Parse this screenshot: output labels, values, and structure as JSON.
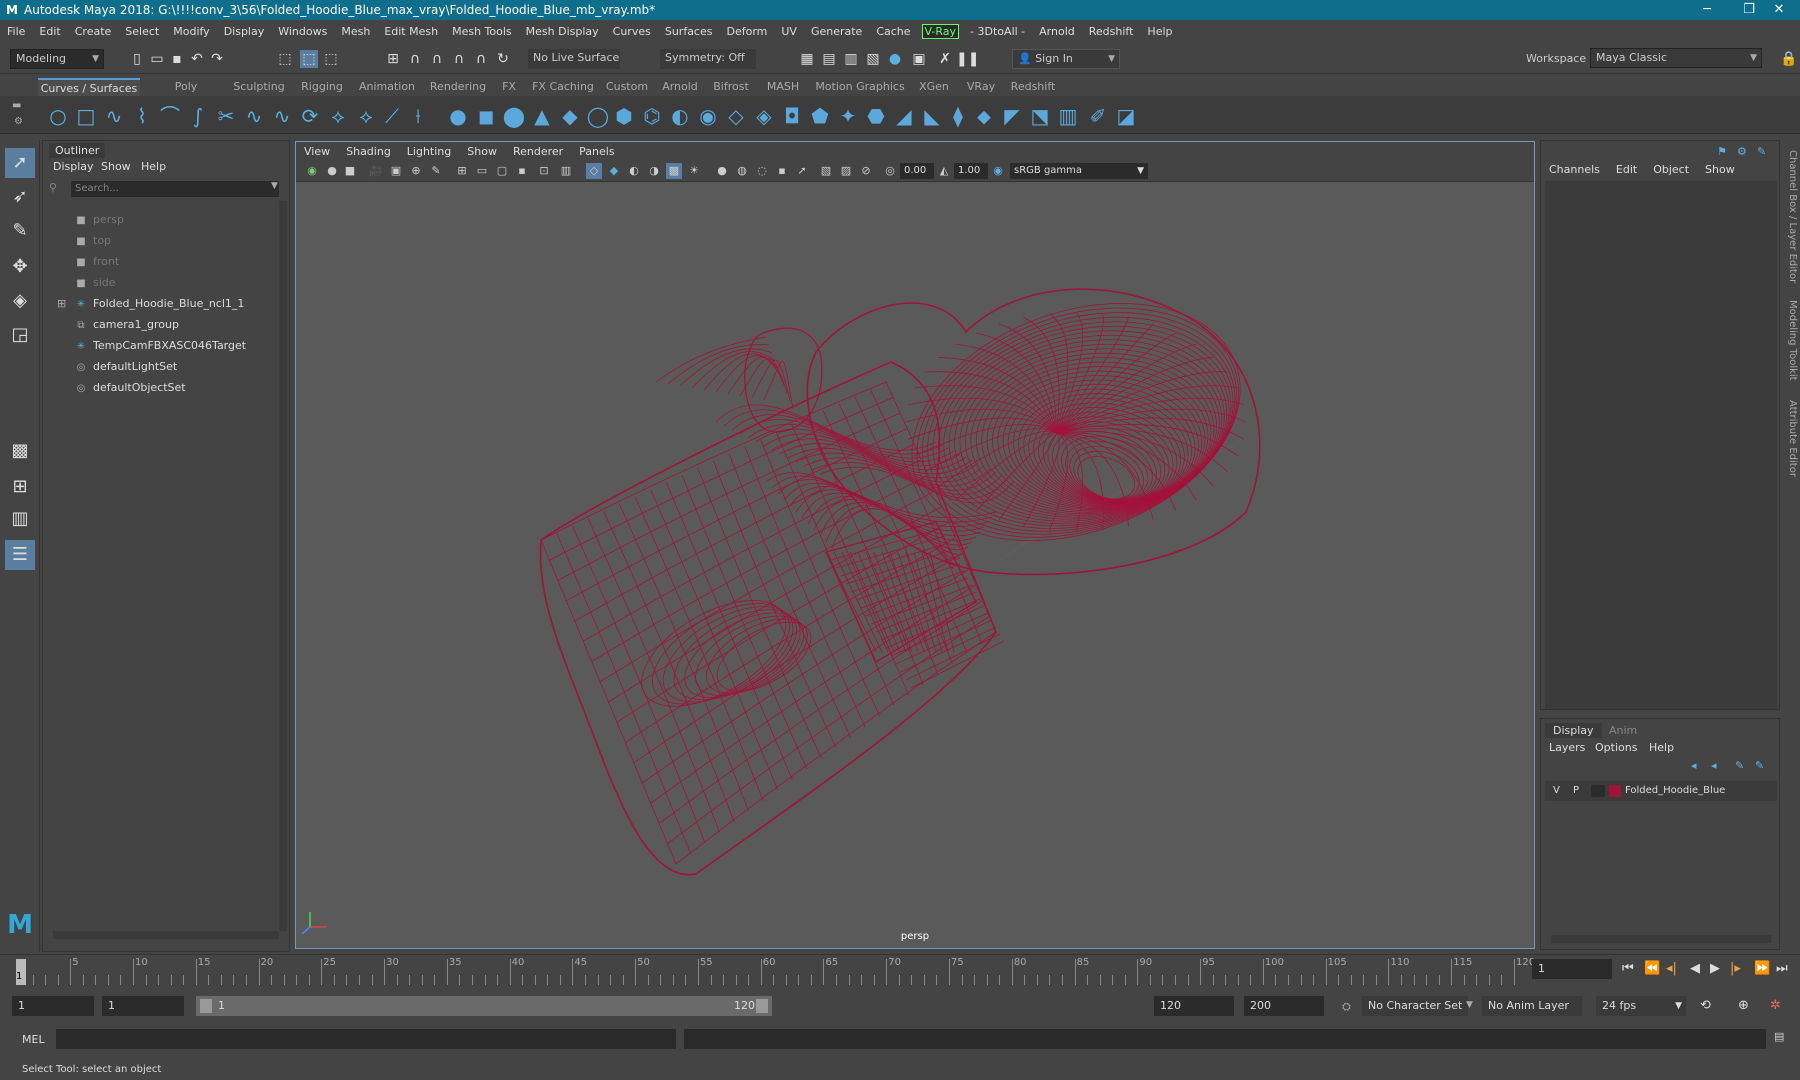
{
  "window": {
    "title": "Autodesk Maya 2018: G:\\!!!!conv_3\\56\\Folded_Hoodie_Blue_max_vray\\Folded_Hoodie_Blue_mb_vray.mb*",
    "minimize": "─",
    "restore": "❐",
    "close": "✕"
  },
  "menubar": {
    "items": [
      "File",
      "Edit",
      "Create",
      "Select",
      "Modify",
      "Display",
      "Windows",
      "Mesh",
      "Edit Mesh",
      "Mesh Tools",
      "Mesh Display",
      "Curves",
      "Surfaces",
      "Deform",
      "UV",
      "Generate",
      "Cache"
    ],
    "vray": "V-Ray",
    "items2": [
      "- 3DtoAll -",
      "Arnold",
      "Redshift",
      "Help"
    ],
    "workspace_label": "Workspace :",
    "workspace_value": "Maya Classic"
  },
  "statusline": {
    "mode": "Modeling",
    "live_surface": "No Live Surface",
    "symmetry": "Symmetry: Off",
    "sign_in": "Sign In"
  },
  "shelf": {
    "tabs": [
      "Curves / Surfaces",
      "Poly Modeling",
      "Sculpting",
      "Rigging",
      "Animation",
      "Rendering",
      "FX",
      "FX Caching",
      "Custom",
      "Arnold",
      "Bifrost",
      "MASH",
      "Motion Graphics",
      "XGen",
      "VRay",
      "Redshift"
    ],
    "active": "Curves / Surfaces"
  },
  "outliner": {
    "title": "Outliner",
    "menu": [
      "Display",
      "Show",
      "Help"
    ],
    "search_placeholder": "Search...",
    "items": [
      {
        "label": "persp",
        "icon": "camera-icon",
        "dim": true
      },
      {
        "label": "top",
        "icon": "camera-icon",
        "dim": true
      },
      {
        "label": "front",
        "icon": "camera-icon",
        "dim": true
      },
      {
        "label": "side",
        "icon": "camera-icon",
        "dim": true
      },
      {
        "label": "Folded_Hoodie_Blue_ncl1_1",
        "icon": "joint-icon",
        "dim": false,
        "expandable": true
      },
      {
        "label": "camera1_group",
        "icon": "group-icon",
        "dim": false
      },
      {
        "label": "TempCamFBXASC046Target",
        "icon": "joint-icon",
        "dim": false
      },
      {
        "label": "defaultLightSet",
        "icon": "set-icon",
        "dim": false
      },
      {
        "label": "defaultObjectSet",
        "icon": "set-icon",
        "dim": false
      }
    ]
  },
  "viewport": {
    "menu": [
      "View",
      "Shading",
      "Lighting",
      "Show",
      "Renderer",
      "Panels"
    ],
    "exposure": "0.00",
    "gamma": "1.00",
    "color_space": "sRGB gamma",
    "camera_label": "persp",
    "wire_color": "#a3123a"
  },
  "channelbox": {
    "menu": [
      "Channels",
      "Edit",
      "Object",
      "Show"
    ],
    "side_tabs": [
      "Channel Box / Layer Editor",
      "Modeling Toolkit",
      "Attribute Editor"
    ]
  },
  "layers": {
    "tabs": [
      "Display",
      "Anim"
    ],
    "active": "Display",
    "menu": [
      "Layers",
      "Options",
      "Help"
    ],
    "row": {
      "v": "V",
      "p": "P",
      "name": "Folded_Hoodie_Blue",
      "color": "#a3123a"
    }
  },
  "timeline": {
    "ticks": [
      1,
      5,
      10,
      15,
      20,
      25,
      30,
      35,
      40,
      45,
      50,
      55,
      60,
      65,
      70,
      75,
      80,
      85,
      90,
      95,
      100,
      105,
      110,
      115,
      120
    ],
    "current_frame": "1"
  },
  "range": {
    "start": "1",
    "playback_start": "1",
    "slider_start": "1",
    "slider_end": "120",
    "playback_end": "120",
    "end": "200",
    "char_set": "No Character Set",
    "anim_layer": "No Anim Layer",
    "fps": "24 fps"
  },
  "cmdline": {
    "label": "MEL"
  },
  "help": {
    "text": "Select Tool: select an object"
  }
}
